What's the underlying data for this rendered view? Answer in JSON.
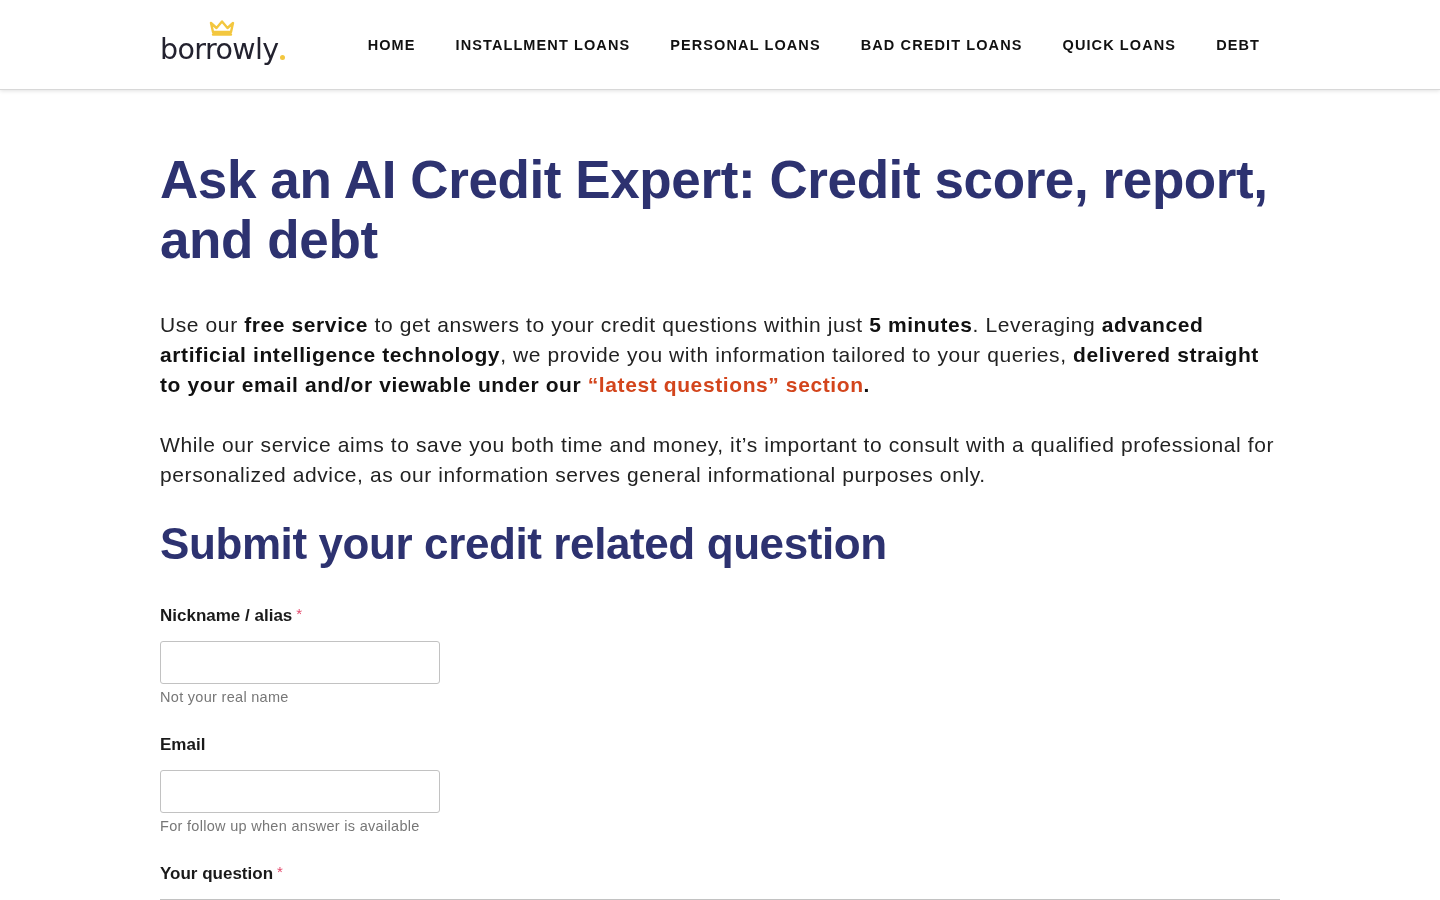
{
  "header": {
    "logo": {
      "text": "borrowly"
    },
    "nav": [
      {
        "label": "HOME"
      },
      {
        "label": "INSTALLMENT LOANS"
      },
      {
        "label": "PERSONAL LOANS"
      },
      {
        "label": "BAD CREDIT LOANS"
      },
      {
        "label": "QUICK LOANS"
      },
      {
        "label": "DEBT"
      }
    ]
  },
  "title": "Ask an AI Credit Expert: Credit score, report, and debt",
  "intro": {
    "text": "Use our **free service** to get answers to your credit questions within just **5 minutes**. Leveraging **advanced artificial intelligence technology**, we provide you with information tailored to your queries, **delivered straight to your email and/or viewable under our** ",
    "link": "“latest questions” section",
    "after": "**.**"
  },
  "disclaimer": "While our service aims to save you both time and money, it’s important to consult with a qualified professional for personalized advice, as our information serves general informational purposes only.",
  "form": {
    "title": "Submit your credit related question",
    "required_mark": "*",
    "fields": [
      {
        "kind": "input",
        "label": "Nickname / alias",
        "required": true,
        "hint": "Not your real name"
      },
      {
        "kind": "input",
        "label": "Email",
        "required": false,
        "hint": "For follow up when answer is available"
      },
      {
        "kind": "textarea",
        "label": "Your question",
        "required": true
      }
    ]
  }
}
